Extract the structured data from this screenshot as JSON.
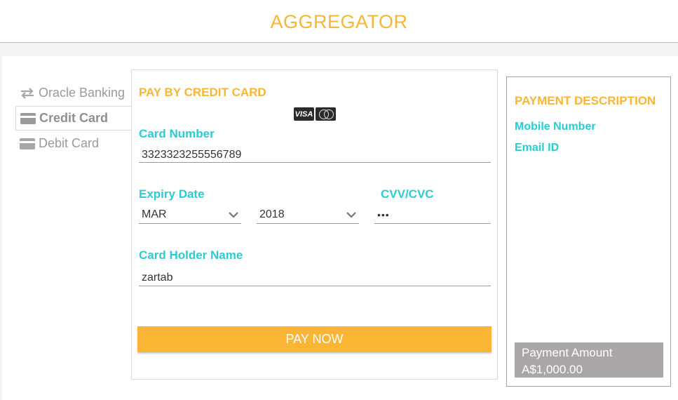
{
  "header": {
    "title": "AGGREGATOR"
  },
  "sidebar": {
    "items": [
      {
        "label": "Oracle Banking",
        "icon": "transfer-icon",
        "active": false
      },
      {
        "label": "Credit Card",
        "icon": "credit-card-icon",
        "active": true
      },
      {
        "label": "Debit Card",
        "icon": "debit-card-icon",
        "active": false
      }
    ]
  },
  "form": {
    "title": "PAY BY CREDIT CARD",
    "card_logos": [
      "VISA",
      "mastercard"
    ],
    "card_number_label": "Card Number",
    "card_number_value": "3323323255556789",
    "expiry_label": "Expiry Date",
    "expiry_month": "MAR",
    "expiry_year": "2018",
    "cvv_label": "CVV/CVC",
    "cvv_value": "•••",
    "holder_label": "Card Holder Name",
    "holder_value": "zartab",
    "pay_button": "PAY NOW"
  },
  "description": {
    "title": "PAYMENT DESCRIPTION",
    "mobile_label": "Mobile Number",
    "email_label": "Email ID",
    "amount_label": "Payment Amount",
    "amount_value": "A$1,000.00"
  },
  "colors": {
    "accent": "#fbb534",
    "label": "#2bcbd3",
    "muted": "#9a9a9a",
    "amount_bg": "#a8a6a6"
  }
}
